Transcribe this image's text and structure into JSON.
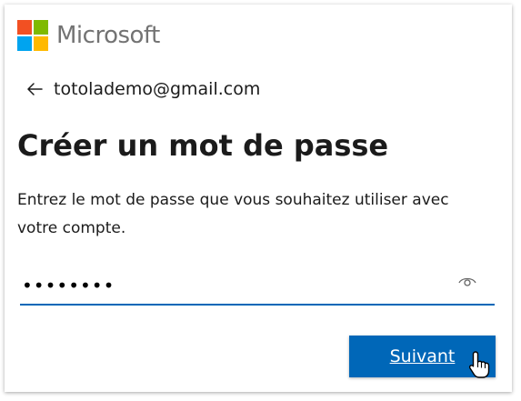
{
  "brand": {
    "name": "Microsoft",
    "logo_colors": [
      "#f25022",
      "#7fba00",
      "#00a4ef",
      "#ffb900"
    ],
    "text_color": "#737373"
  },
  "identity": {
    "email": "totolademo@gmail.com",
    "back_icon": "arrow-left-icon"
  },
  "page": {
    "title": "Créer un mot de passe",
    "description": "Entrez le mot de passe que vous souhaitez utiliser avec votre compte."
  },
  "password_field": {
    "value": "••••••••",
    "reveal_icon": "eye-icon"
  },
  "actions": {
    "next_label": "Suivant"
  },
  "colors": {
    "accent": "#0067b8",
    "text": "#1b1b1b"
  }
}
